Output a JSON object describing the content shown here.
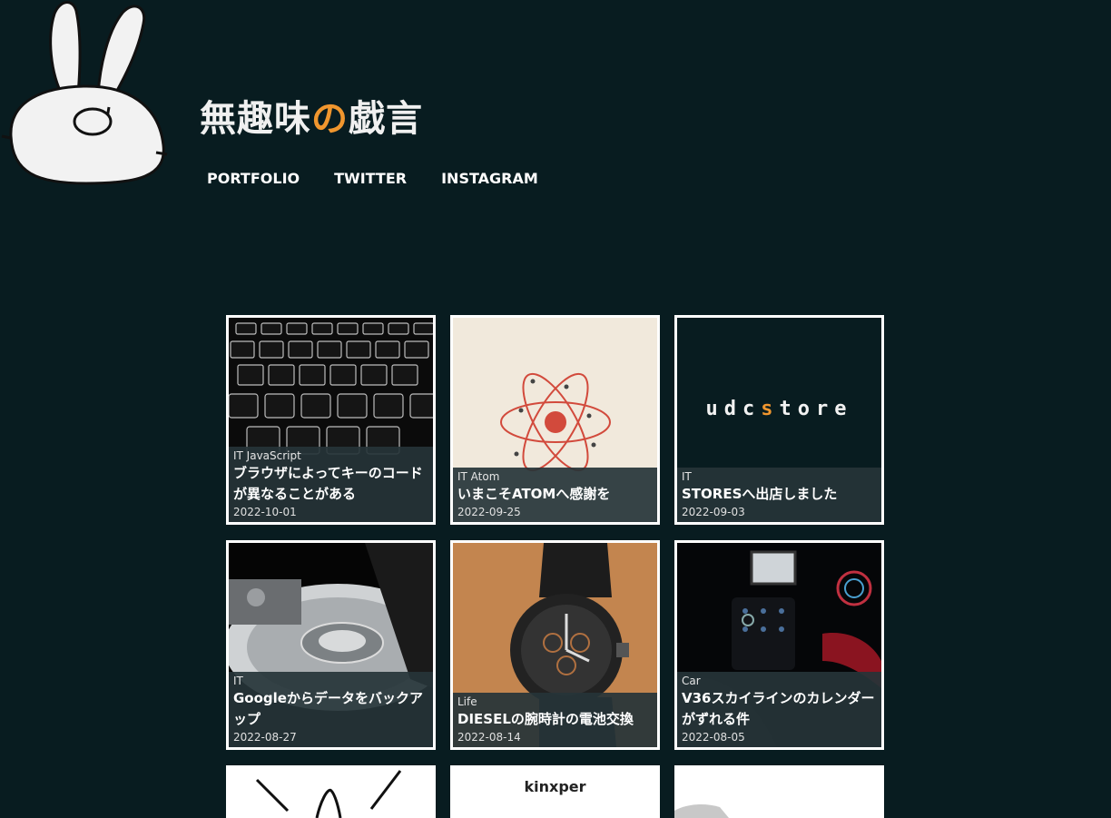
{
  "site": {
    "title_part1": "無趣味",
    "title_accent": "の",
    "title_part2": "戯言",
    "accent_color": "#f0962e"
  },
  "nav": [
    "PORTFOLIO",
    "TWITTER",
    "INSTAGRAM"
  ],
  "posts": [
    {
      "categories": "IT JavaScript",
      "title": "ブラウザによってキーのコードが異なることがある",
      "date": "2022-10-01",
      "thumb": "keyboard-image"
    },
    {
      "categories": "IT Atom",
      "title": "いまこそATOMへ感謝を",
      "date": "2022-09-25",
      "thumb": "atom-logo-image"
    },
    {
      "categories": "IT",
      "title": "STORESへ出店しました",
      "date": "2022-09-03",
      "thumb": "udcstore-logo-image",
      "logo_text_a": "udc",
      "logo_text_s": "s",
      "logo_text_b": "tore"
    },
    {
      "categories": "IT",
      "title": "Googleからデータをバックアップ",
      "date": "2022-08-27",
      "thumb": "hard-disk-image"
    },
    {
      "categories": "Life",
      "title": "DIESELの腕時計の電池交換",
      "date": "2022-08-14",
      "thumb": "wristwatch-image"
    },
    {
      "categories": "Car",
      "title": "V36スカイラインのカレンダーがずれる件",
      "date": "2022-08-05",
      "thumb": "car-dashboard-image"
    }
  ],
  "partial_posts": [
    {
      "thumb": "line-drawing-image"
    },
    {
      "thumb": "kinxper-logo-image",
      "logo_text": "kinxper"
    },
    {
      "thumb": "gray-object-image"
    }
  ]
}
